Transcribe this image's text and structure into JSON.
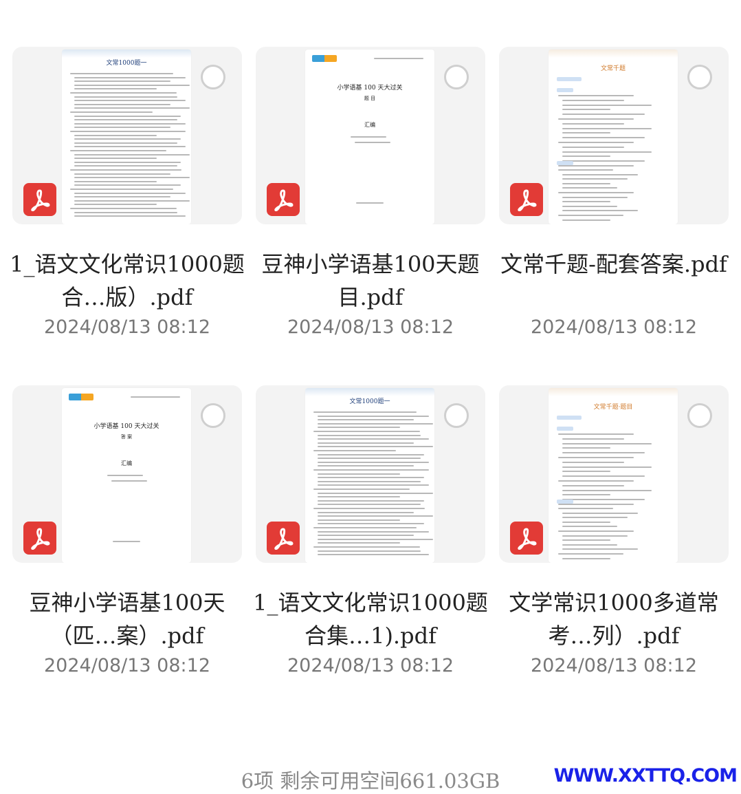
{
  "files": [
    {
      "name": "1_语文文化常识1000题合…版）.pdf",
      "date": "2024/08/13 08:12",
      "thumb_title": "文常1000题一",
      "style": "text"
    },
    {
      "name": "豆神小学语基100天题目.pdf",
      "date": "2024/08/13 08:12",
      "thumb_title": "小学语基 100 天大过关",
      "thumb_sub": "题 目",
      "thumb_mid": "汇编",
      "style": "cover"
    },
    {
      "name": "文常千题-配套答案.pdf",
      "date": "2024/08/13 08:12",
      "thumb_title": "文常千题",
      "style": "quiz"
    },
    {
      "name": "豆神小学语基100天（匹…案）.pdf",
      "date": "2024/08/13 08:12",
      "thumb_title": "小学语基 100 天大过关",
      "thumb_sub": "答 案",
      "thumb_mid": "汇编",
      "style": "cover"
    },
    {
      "name": "1_语文文化常识1000题合集…1).pdf",
      "date": "2024/08/13 08:12",
      "thumb_title": "文常1000题一",
      "style": "text"
    },
    {
      "name": "文学常识1000多道常考…列）.pdf",
      "date": "2024/08/13 08:12",
      "thumb_title": "文常千题·题目",
      "style": "quiz"
    }
  ],
  "footer": {
    "summary": "6项 剩余可用空间661.03GB"
  },
  "watermark": "WWW.XXTTQ.COM",
  "colors": {
    "pdf_icon": "#e23b36",
    "watermark": "#1a22e8"
  }
}
